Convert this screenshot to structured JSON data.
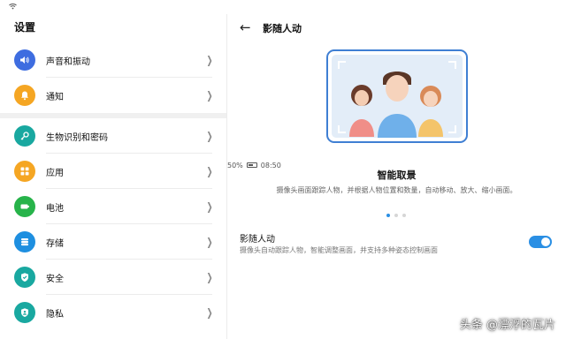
{
  "statusbar": {
    "battery": "50%",
    "time": "08:50"
  },
  "sidebar": {
    "title": "设置",
    "items": [
      {
        "label": "声音和振动",
        "icon": "volume-icon",
        "color": "#3e6de0"
      },
      {
        "label": "通知",
        "icon": "bell-icon",
        "color": "#f5a623"
      },
      {
        "label": "生物识别和密码",
        "icon": "key-icon",
        "color": "#19a8a0"
      },
      {
        "label": "应用",
        "icon": "apps-grid-icon",
        "color": "#f5a623"
      },
      {
        "label": "电池",
        "icon": "battery-icon",
        "color": "#27b34a"
      },
      {
        "label": "存储",
        "icon": "storage-icon",
        "color": "#1e8fe0"
      },
      {
        "label": "安全",
        "icon": "shield-icon",
        "color": "#19a8a0"
      },
      {
        "label": "隐私",
        "icon": "privacy-shield-icon",
        "color": "#19a8a0"
      }
    ]
  },
  "detail": {
    "title": "影随人动",
    "feature_title": "智能取景",
    "feature_desc": "摄像头画面跟踪人物，并根据人物位置和数量，自动移动、放大、缩小画面。",
    "option": {
      "label": "影随人动",
      "desc": "摄像头自动跟踪人物，智能调整画面，并支持多种姿态控制画面",
      "enabled": true
    },
    "pager": {
      "pages": 3,
      "current": 1
    }
  },
  "colors": {
    "accent": "#2a8fe4"
  },
  "watermark": "头条 @漂浮的瓦片"
}
